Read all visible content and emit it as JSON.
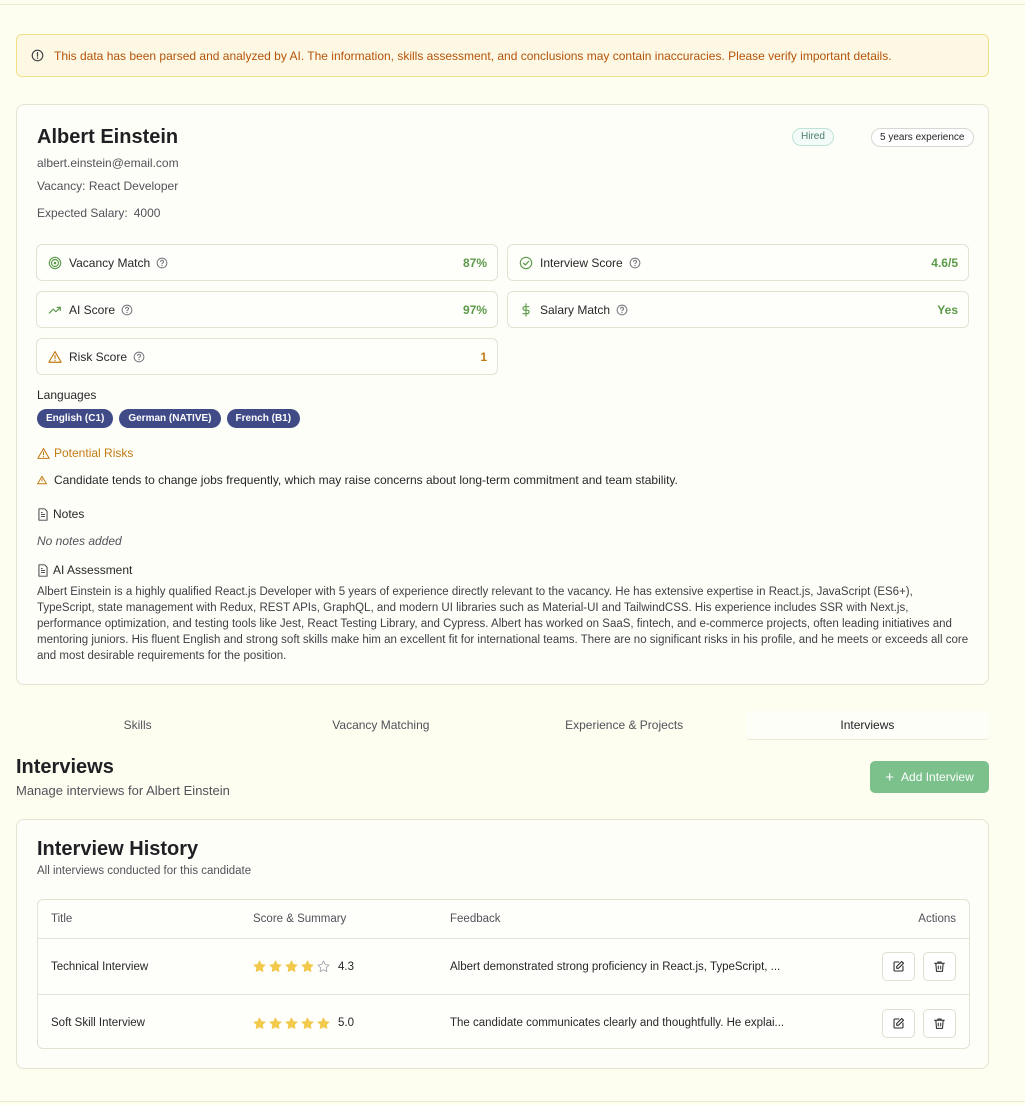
{
  "alert": {
    "text": "This data has been parsed and analyzed by AI. The information, skills assessment, and conclusions may contain inaccuracies. Please verify important details."
  },
  "candidate": {
    "name": "Albert Einstein",
    "email": "albert.einstein@email.com",
    "vacancy_label": "Vacancy:",
    "vacancy": "React Developer",
    "salary_label": "Expected Salary:",
    "salary": "4000",
    "status_badge": "Hired",
    "experience_badge": "5 years experience"
  },
  "metrics": {
    "vacancy_match": {
      "label": "Vacancy Match",
      "value": "87%"
    },
    "interview_score": {
      "label": "Interview Score",
      "value": "4.6/5"
    },
    "ai_score": {
      "label": "AI Score",
      "value": "97%"
    },
    "salary_match": {
      "label": "Salary Match",
      "value": "Yes"
    },
    "risk_score": {
      "label": "Risk Score",
      "value": "1"
    }
  },
  "languages": {
    "title": "Languages",
    "items": [
      "English (C1)",
      "German (NATIVE)",
      "French (B1)"
    ]
  },
  "risks": {
    "title": "Potential Risks",
    "items": [
      "Candidate tends to change jobs frequently, which may raise concerns about long-term commitment and team stability."
    ]
  },
  "notes": {
    "title": "Notes",
    "empty": "No notes added"
  },
  "ai_assessment": {
    "title": "AI Assessment",
    "text": "Albert Einstein is a highly qualified React.js Developer with 5 years of experience directly relevant to the vacancy. He has extensive expertise in React.js, JavaScript (ES6+), TypeScript, state management with Redux, REST APIs, GraphQL, and modern UI libraries such as Material-UI and TailwindCSS. His experience includes SSR with Next.js, performance optimization, and testing tools like Jest, React Testing Library, and Cypress. Albert has worked on SaaS, fintech, and e-commerce projects, often leading initiatives and mentoring juniors. His fluent English and strong soft skills make him an excellent fit for international teams. There are no significant risks in his profile, and he meets or exceeds all core and most desirable requirements for the position."
  },
  "tabs": [
    "Skills",
    "Vacancy Matching",
    "Experience & Projects",
    "Interviews"
  ],
  "active_tab": "Interviews",
  "interviews": {
    "title": "Interviews",
    "subtitle": "Manage interviews for Albert Einstein",
    "add_button": "Add Interview",
    "history_title": "Interview History",
    "history_subtitle": "All interviews conducted for this candidate",
    "columns": [
      "Title",
      "Score & Summary",
      "Feedback",
      "Actions"
    ],
    "rows": [
      {
        "title": "Technical Interview",
        "rating": 4,
        "score": "4.3",
        "feedback": "Albert demonstrated strong proficiency in React.js, TypeScript, ..."
      },
      {
        "title": "Soft Skill Interview",
        "rating": 5,
        "score": "5.0",
        "feedback": "The candidate communicates clearly and thoughtfully. He explai..."
      }
    ]
  },
  "colors": {
    "accent_green": "#5b9a49",
    "warning_orange": "#c27a13",
    "language_tag": "#3f4a86",
    "button_green": "#7cc18c",
    "star_yellow": "#f2c94c"
  }
}
